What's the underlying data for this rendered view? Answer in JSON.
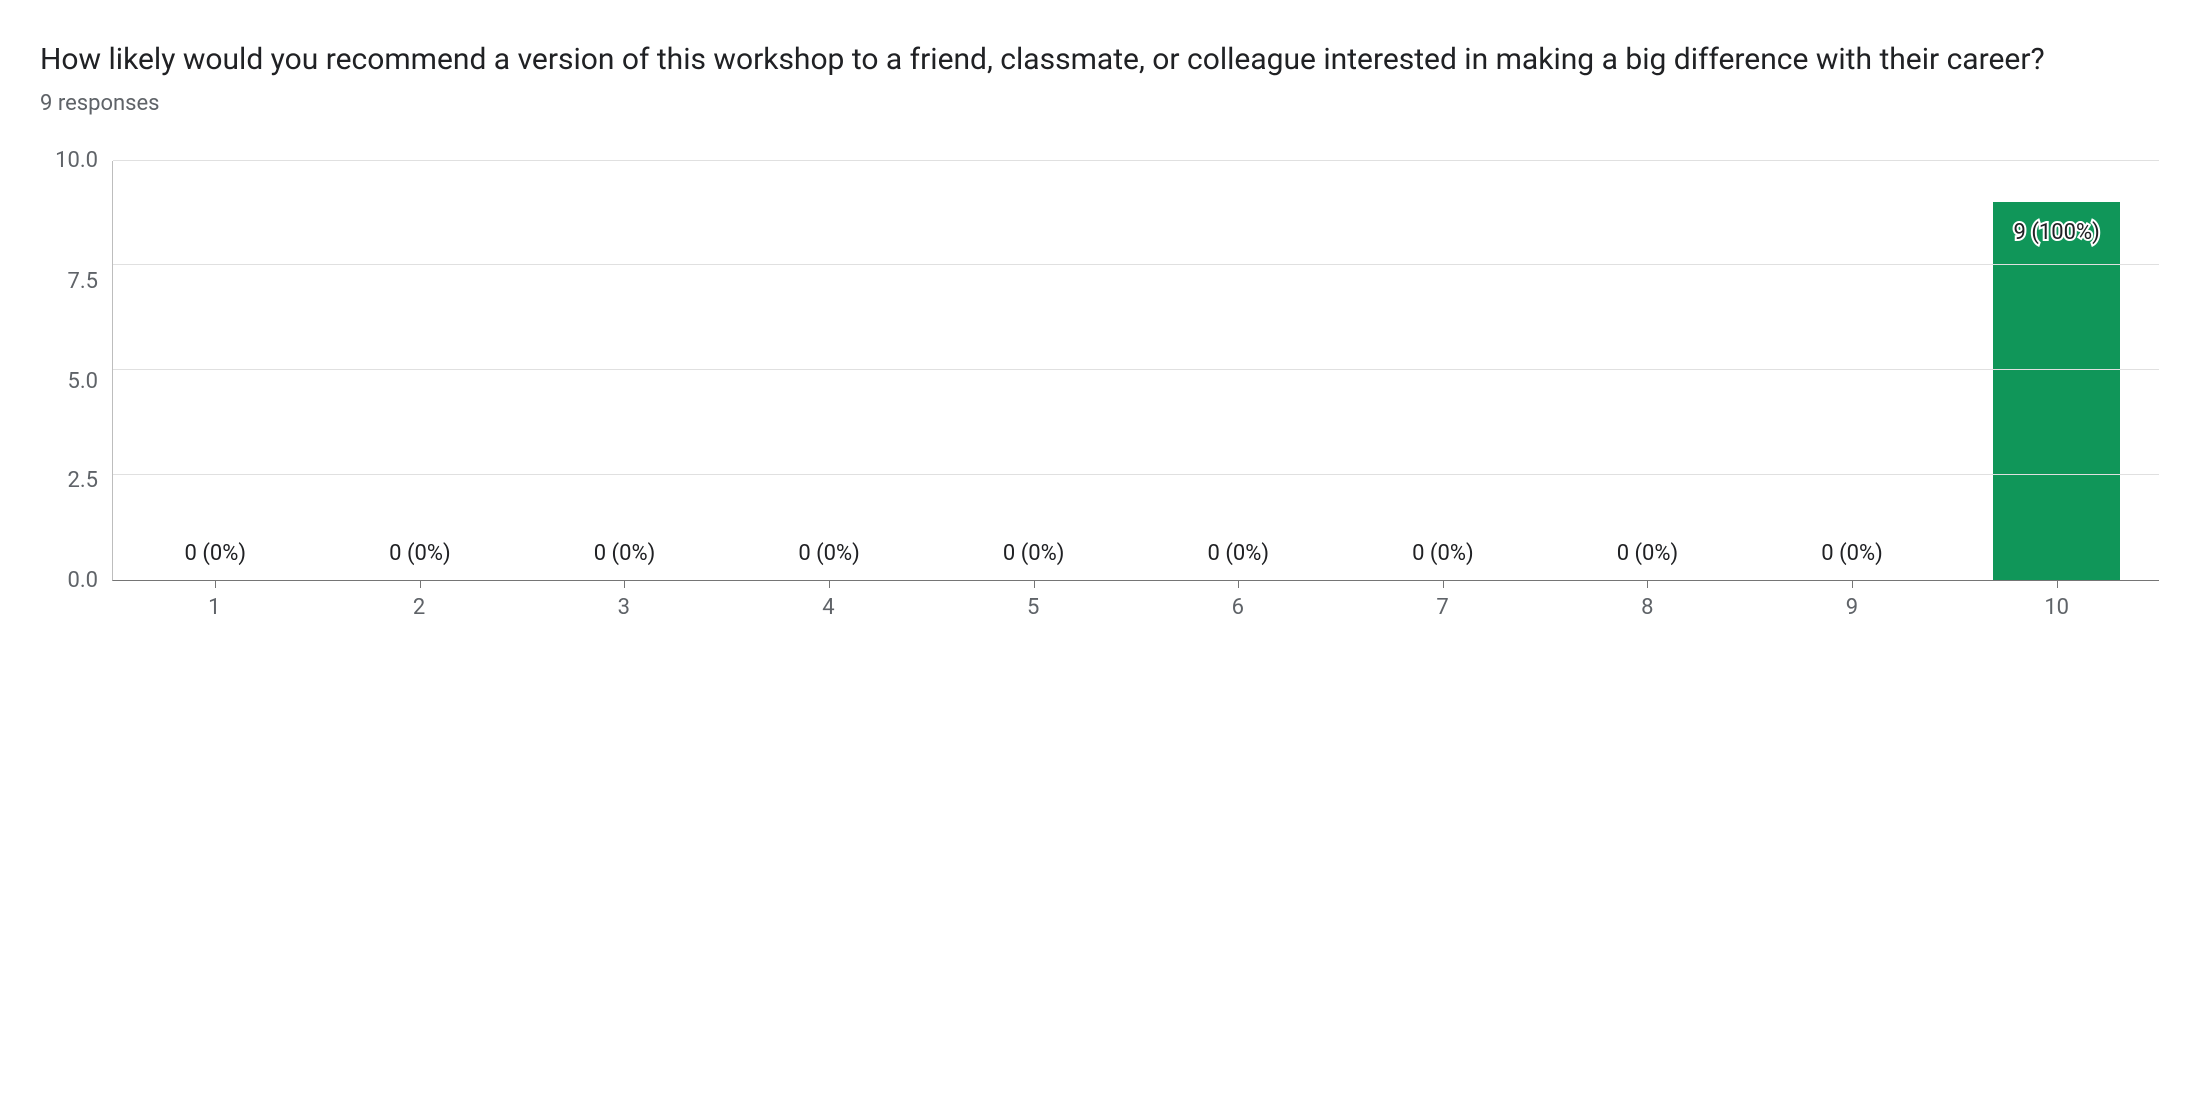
{
  "title": "How likely would you recommend a version of this workshop to a friend, classmate, or colleague interested in making a big difference with their career?",
  "subtitle": "9 responses",
  "chart_data": {
    "type": "bar",
    "categories": [
      "1",
      "2",
      "3",
      "4",
      "5",
      "6",
      "7",
      "8",
      "9",
      "10"
    ],
    "values": [
      0,
      0,
      0,
      0,
      0,
      0,
      0,
      0,
      0,
      9
    ],
    "percents": [
      "0%",
      "0%",
      "0%",
      "0%",
      "0%",
      "0%",
      "0%",
      "0%",
      "0%",
      "100%"
    ],
    "data_labels": [
      "0 (0%)",
      "0 (0%)",
      "0 (0%)",
      "0 (0%)",
      "0 (0%)",
      "0 (0%)",
      "0 (0%)",
      "0 (0%)",
      "0 (0%)",
      "9 (100%)"
    ],
    "ylim": [
      0,
      10
    ],
    "y_ticks": [
      "10.0",
      "7.5",
      "5.0",
      "2.5",
      "0.0"
    ],
    "bar_color": "#109659",
    "title": "",
    "xlabel": "",
    "ylabel": ""
  }
}
